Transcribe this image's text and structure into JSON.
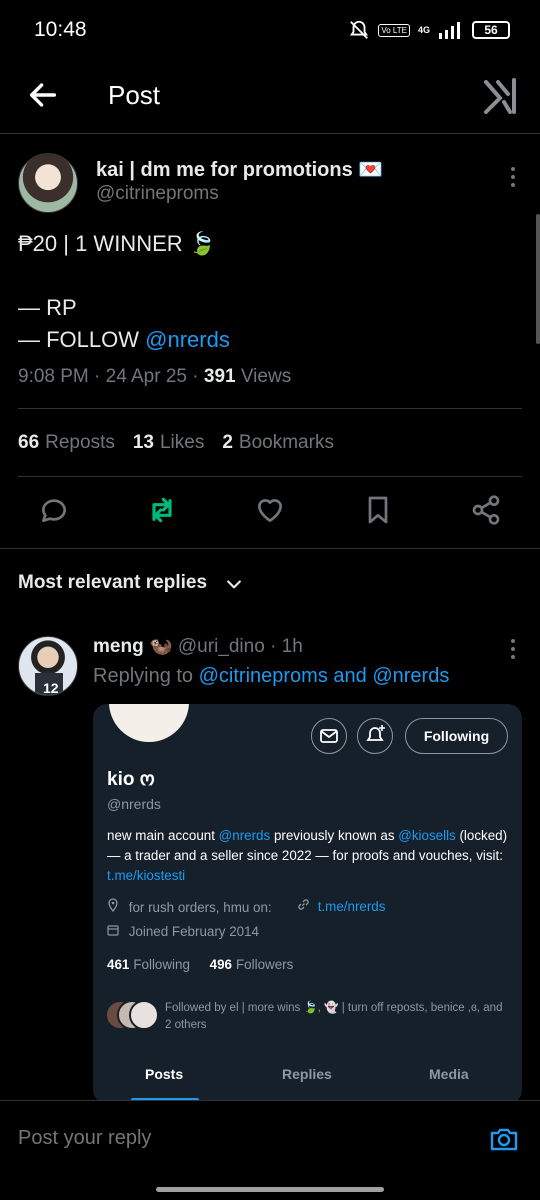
{
  "status_bar": {
    "time": "10:48",
    "battery": "56",
    "network": "4G",
    "volte": "Vo LTE"
  },
  "header": {
    "title": "Post"
  },
  "post": {
    "author_name": "kai | dm me for promotions 💌",
    "author_handle": "@citrineproms",
    "line1": "₱20 | 1 WINNER 🍃",
    "line2": "— RP",
    "line3_prefix": "— FOLLOW ",
    "line3_mention": "@nrerds",
    "time": "9:08 PM · 24 Apr 25 · ",
    "views_count": "391",
    "views_label": " Views",
    "reposts_count": "66",
    "reposts_label": "Reposts",
    "likes_count": "13",
    "likes_label": "Likes",
    "bookmarks_count": "2",
    "bookmarks_label": "Bookmarks"
  },
  "replies_sort": {
    "label": "Most relevant replies"
  },
  "reply": {
    "name": "meng 🦦",
    "handle": "@uri_dino",
    "time": "· 1h",
    "replying_prefix": "Replying to ",
    "replying_to": "@citrineproms and @nrerds",
    "card": {
      "follow_label": "Following",
      "name": "kio ო",
      "handle": "@nrerds",
      "bio_a": "new main account ",
      "bio_m1": "@nrerds",
      "bio_b": " previously known as ",
      "bio_m2": "@kiosells",
      "bio_c": " (locked) — a trader and a seller since 2022 — for proofs and vouches, visit: ",
      "bio_link": "t.me/kiostesti",
      "location": "for rush orders, hmu on:",
      "website": "t.me/nrerds",
      "joined": "Joined February 2014",
      "following_count": "461",
      "following_label": "Following",
      "followers_count": "496",
      "followers_label": "Followers",
      "followed_by": "Followed by el | more wins 🍃, 👻 | turn off reposts, benice ,ɞ, and 2 others",
      "tabs": [
        "Posts",
        "Replies",
        "Media"
      ]
    }
  },
  "reply_bar": {
    "placeholder": "Post your reply"
  },
  "colors": {
    "accent": "#1d9bf0",
    "repost_active": "#00ba7c",
    "bg": "#000000",
    "card_bg": "#15202b"
  }
}
